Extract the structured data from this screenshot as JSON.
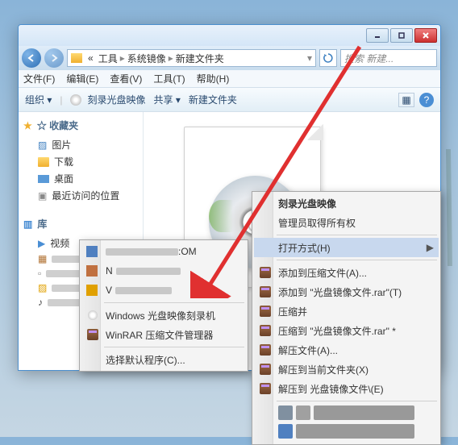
{
  "breadcrumb": {
    "prefix": "«",
    "parts": [
      "工具",
      "系统镜像",
      "新建文件夹"
    ]
  },
  "search": {
    "placeholder": "搜索 新建..."
  },
  "menus": [
    "文件(F)",
    "编辑(E)",
    "查看(V)",
    "工具(T)",
    "帮助(H)"
  ],
  "toolbar": {
    "organize": "组织 ▾",
    "burn": "刻录光盘映像",
    "share": "共享 ▾",
    "burnto": "新建文件夹"
  },
  "sidebar": {
    "fav": {
      "head": "☆ 收藏夹",
      "items": [
        "图片",
        "下载",
        "桌面",
        "最近访问的位置"
      ]
    },
    "lib": {
      "head": "库",
      "items": [
        "视频"
      ]
    }
  },
  "openwith": {
    "rows": [
      {
        "name": "open-with-row-0",
        "label": ":OM"
      },
      {
        "name": "open-with-row-1",
        "label": "N"
      },
      {
        "name": "open-with-row-2",
        "label": "V"
      }
    ],
    "burn": "Windows 光盘映像刻录机",
    "winrar": "WinRAR 压缩文件管理器",
    "choose": "选择默认程序(C)..."
  },
  "context": {
    "burn_image": "刻录光盘映像",
    "admin": "管理员取得所有权",
    "open_with": "打开方式(H)",
    "add_archive": "添加到压缩文件(A)...",
    "add_named": "添加到 \"光盘镜像文件.rar\"(T)",
    "compress_email": "压缩并",
    "compress_to_email": "压缩到 \"光盘镜像文件.rar\" *",
    "extract": "解压文件(A)...",
    "extract_here": "解压到当前文件夹(X)",
    "extract_to": "解压到 光盘镜像文件\\(E)"
  }
}
